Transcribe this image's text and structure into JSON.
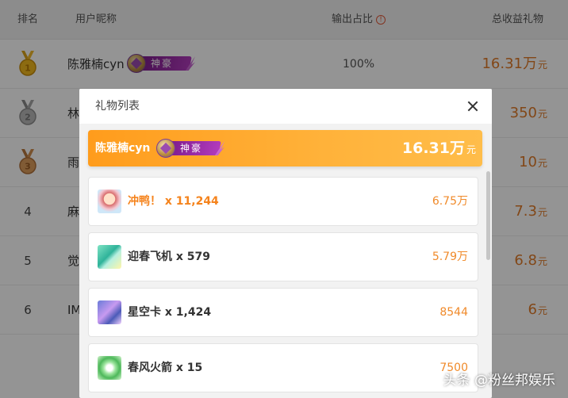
{
  "table": {
    "headers": {
      "rank": "排名",
      "name": "用户昵称",
      "ratio": "输出占比",
      "info_icon": "!",
      "gift": "总收益礼物"
    },
    "rows": [
      {
        "rank": "1",
        "medal": "gold",
        "name": "陈雅楠cyn",
        "badge": "神豪",
        "ratio": "100%",
        "amount": "16.31万",
        "unit": "元"
      },
      {
        "rank": "2",
        "medal": "silver",
        "name": "林",
        "ratio": "",
        "amount": "350",
        "unit": "元"
      },
      {
        "rank": "3",
        "medal": "bronze",
        "name": "雨",
        "ratio": "",
        "amount": "10",
        "unit": "元"
      },
      {
        "rank": "4",
        "name": "麻",
        "ratio": "",
        "amount": "7.3",
        "unit": "元"
      },
      {
        "rank": "5",
        "name": "觉",
        "ratio": "",
        "amount": "6.8",
        "unit": "元"
      },
      {
        "rank": "6",
        "name": "IM",
        "ratio": "",
        "amount": "6",
        "unit": "元"
      }
    ]
  },
  "modal": {
    "title": "礼物列表",
    "banner": {
      "name": "陈雅楠cyn",
      "badge": "神豪",
      "total": "16.31万",
      "unit": "元"
    },
    "gifts": [
      {
        "name": "冲鸭！ x 11,244",
        "value": "6.75万",
        "icon": "duck-gift-icon"
      },
      {
        "name": "迎春飞机 x 579",
        "value": "5.79万",
        "icon": "plane-gift-icon"
      },
      {
        "name": "星空卡 x 1,424",
        "value": "8544",
        "icon": "star-card-gift-icon"
      },
      {
        "name": "春风火箭 x 15",
        "value": "7500",
        "icon": "rocket-gift-icon"
      }
    ]
  },
  "watermark": "头条 @粉丝邦娱乐",
  "colors": {
    "accent": "#f08a2a",
    "badge": "#9b2fa8",
    "banner": "#ffa726"
  }
}
